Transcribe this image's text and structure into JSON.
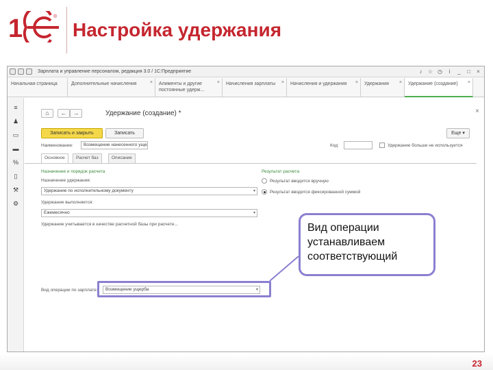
{
  "slide": {
    "title": "Настройка удержания",
    "page_number": "23",
    "logo_color": "#c5262f",
    "callout_text": "Вид операции устанавливаем соответствующий",
    "callout_color": "#8a7fd0"
  },
  "app": {
    "window_title": "Зарплата и управление персоналом, редакция 3.0 / 1С:Предприятие",
    "tabs": [
      {
        "label": "Начальная страница"
      },
      {
        "label": "Дополнительные начисления"
      },
      {
        "label": "Алименты и другие постоянные удерж..."
      },
      {
        "label": "Начисления зарплаты"
      },
      {
        "label": "Начисления и удержания"
      },
      {
        "label": "Удержания"
      },
      {
        "label": "Удержание (создание)",
        "active": true
      }
    ],
    "form": {
      "title": "Удержание (создание) *",
      "save_close_button": "Записать и закрыть",
      "save_button": "Записать",
      "more_button": "Еще",
      "name_label": "Наименование:",
      "name_value": "Возмещение нанесенного ущерба",
      "code_label": "Код:",
      "unused_label": "Удержание больше не используется",
      "tabs": [
        "Основное",
        "Расчет баз",
        "Описание"
      ],
      "purpose_label": "Назначение и порядок расчета",
      "purpose_title_label": "Назначение удержания:",
      "purpose_value": "Удержание по исполнительному документу",
      "op_label": "Удержание выполняется:",
      "op_value": "Ежемесячно",
      "calc_label": "Удержание учитывается в качестве расчетной базы при расчете...",
      "result_label": "Результат расчета",
      "radio1_label": "Результат вводится вручную",
      "radio2_label": "Результат вводится фиксированной суммой",
      "operation_type_label": "Вид операции по зарплате:",
      "operation_type_value": "Возмещение ущерба"
    }
  }
}
